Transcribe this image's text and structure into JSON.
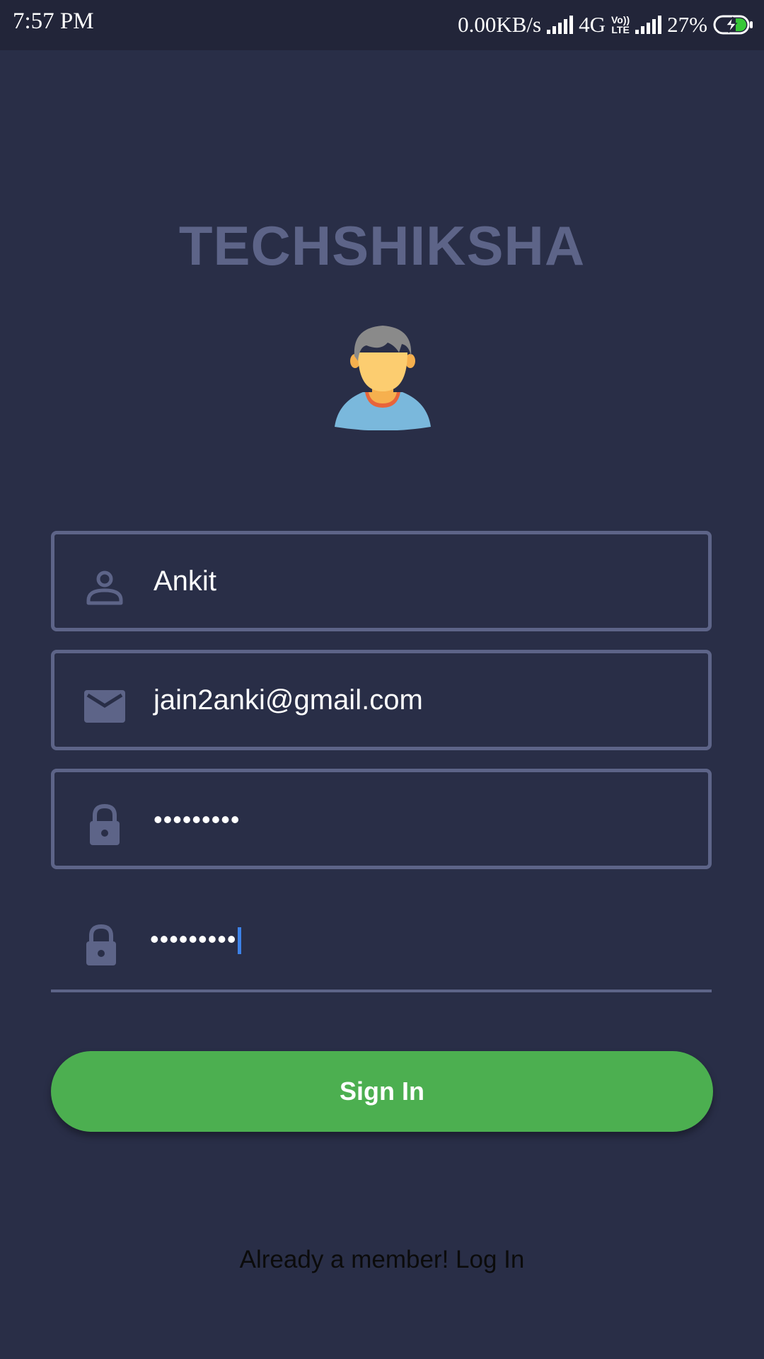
{
  "status_bar": {
    "time": "7:57 PM",
    "net_speed": "0.00KB/s",
    "network": "4G",
    "volte_top": "Vo))",
    "volte_bottom": "LTE",
    "battery": "27%"
  },
  "app": {
    "title": "TECHSHIKSHA"
  },
  "form": {
    "name_value": "Ankit",
    "email_value": "jain2anki@gmail.com",
    "password_value": "•••••••••",
    "confirm_password_value": "•••••••••"
  },
  "buttons": {
    "sign_in": "Sign In"
  },
  "footer": {
    "login_link": "Already a member! Log In"
  },
  "colors": {
    "background": "#292e47",
    "accent": "#4caf50",
    "muted": "#5d6488"
  },
  "icons": [
    "person-icon",
    "mail-icon",
    "lock-icon",
    "lock-icon",
    "avatar-icon"
  ]
}
